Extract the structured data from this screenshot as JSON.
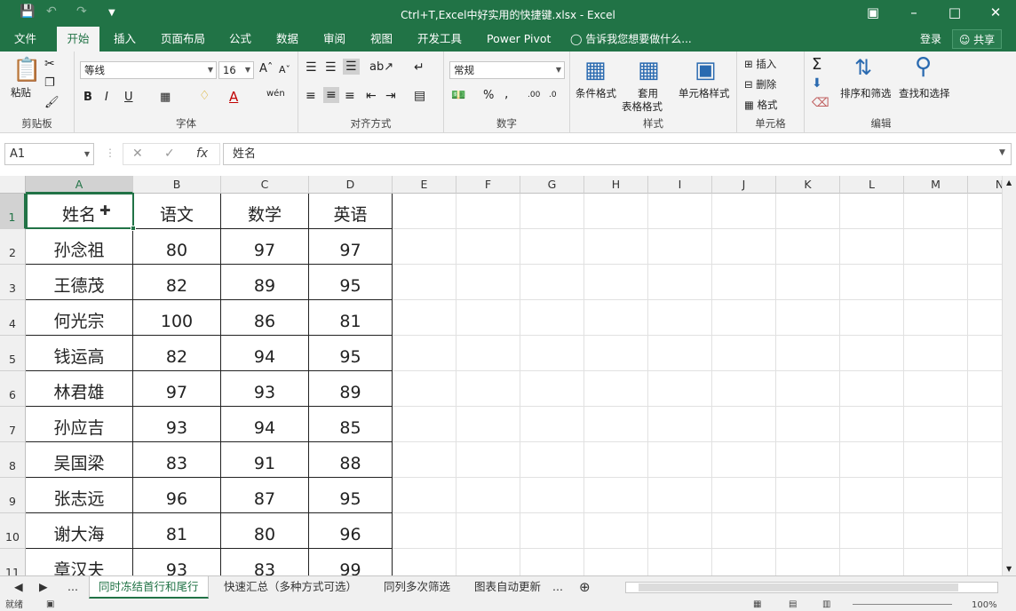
{
  "window": {
    "title": "Ctrl+T,Excel中好实用的快捷键.xlsx - Excel"
  },
  "menu": {
    "tabs": [
      "文件",
      "开始",
      "插入",
      "页面布局",
      "公式",
      "数据",
      "审阅",
      "视图",
      "开发工具",
      "Power Pivot"
    ],
    "active_tab": "开始",
    "tell_me": "告诉我您想要做什么...",
    "login": "登录",
    "share": "共享"
  },
  "ribbon": {
    "clipboard": {
      "paste": "粘贴",
      "label": "剪贴板"
    },
    "font": {
      "name": "等线",
      "size": "16",
      "label": "字体"
    },
    "alignment": {
      "label": "对齐方式"
    },
    "number": {
      "format": "常规",
      "label": "数字"
    },
    "styles": {
      "conditional": "条件格式",
      "table_line1": "套用",
      "table_line2": "表格格式",
      "cell_styles": "单元格样式",
      "label": "样式"
    },
    "cells": {
      "insert": "插入",
      "delete": "删除",
      "format": "格式",
      "label": "单元格"
    },
    "editing": {
      "sort": "排序和筛选",
      "find": "查找和选择",
      "label": "编辑"
    }
  },
  "formula_bar": {
    "name_box": "A1",
    "formula": "姓名"
  },
  "columns": [
    "A",
    "B",
    "C",
    "D",
    "E",
    "F",
    "G",
    "H",
    "I",
    "J",
    "K",
    "L",
    "M",
    "N"
  ],
  "rows": [
    "1",
    "2",
    "3",
    "4",
    "5",
    "6",
    "7",
    "8",
    "9",
    "10",
    "11"
  ],
  "table": {
    "headers": [
      "姓名",
      "语文",
      "数学",
      "英语"
    ],
    "rows": [
      [
        "孙念祖",
        "80",
        "97",
        "97"
      ],
      [
        "王德茂",
        "82",
        "89",
        "95"
      ],
      [
        "何光宗",
        "100",
        "86",
        "81"
      ],
      [
        "钱运高",
        "82",
        "94",
        "95"
      ],
      [
        "林君雄",
        "97",
        "93",
        "89"
      ],
      [
        "孙应吉",
        "93",
        "94",
        "85"
      ],
      [
        "吴国梁",
        "83",
        "91",
        "88"
      ],
      [
        "张志远",
        "96",
        "87",
        "95"
      ],
      [
        "谢大海",
        "81",
        "80",
        "96"
      ],
      [
        "章汉夫",
        "93",
        "83",
        "99"
      ]
    ]
  },
  "sheet_tabs": {
    "more": "...",
    "tabs": [
      "同时冻结首行和尾行",
      "快速汇总（多种方式可选）",
      "同列多次筛选",
      "图表自动更新"
    ],
    "active": "同时冻结首行和尾行",
    "trailing": "..."
  },
  "status": {
    "ready": "就绪",
    "zoom": "100%"
  },
  "colors": {
    "accent": "#217346"
  }
}
